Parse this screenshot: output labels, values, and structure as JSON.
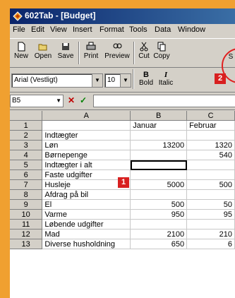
{
  "window": {
    "title": "602Tab - [Budget]"
  },
  "menu": [
    "File",
    "Edit",
    "View",
    "Insert",
    "Format",
    "Tools",
    "Data",
    "Window"
  ],
  "toolbar": {
    "new": "New",
    "open": "Open",
    "save": "Save",
    "print": "Print",
    "preview": "Preview",
    "cut": "Cut",
    "copy": "Copy",
    "partial": "S"
  },
  "format_toolbar": {
    "font": "Arial (Vestligt)",
    "size": "10",
    "bold": "Bold",
    "italic": "Italic",
    "bold_glyph": "B",
    "italic_glyph": "I"
  },
  "formula_bar": {
    "cell_ref": "B5",
    "cancel": "✕",
    "accept": "✓",
    "content": ""
  },
  "callouts": {
    "one": "1",
    "two": "2"
  },
  "sheet": {
    "columns": [
      "A",
      "B",
      "C"
    ],
    "rows": [
      {
        "n": "1",
        "a": "",
        "b": "Januar",
        "c": "Februar"
      },
      {
        "n": "2",
        "a": "Indtægter",
        "b": "",
        "c": ""
      },
      {
        "n": "3",
        "a": "Løn",
        "b": "13200",
        "c": "1320"
      },
      {
        "n": "4",
        "a": "Børnepenge",
        "b": "",
        "c": "540"
      },
      {
        "n": "5",
        "a": "Indtægter i alt",
        "b": "",
        "c": ""
      },
      {
        "n": "6",
        "a": "Faste udgifter",
        "b": "",
        "c": ""
      },
      {
        "n": "7",
        "a": "Husleje",
        "b": "5000",
        "c": "500"
      },
      {
        "n": "8",
        "a": "Afdrag på bil",
        "b": "",
        "c": ""
      },
      {
        "n": "9",
        "a": "El",
        "b": "500",
        "c": "50"
      },
      {
        "n": "10",
        "a": "Varme",
        "b": "950",
        "c": "95"
      },
      {
        "n": "11",
        "a": "Løbende udgifter",
        "b": "",
        "c": ""
      },
      {
        "n": "12",
        "a": "Mad",
        "b": "2100",
        "c": "210"
      },
      {
        "n": "13",
        "a": "Diverse husholdning",
        "b": "650",
        "c": "6"
      }
    ]
  },
  "colors": {
    "callout": "#d82020",
    "titlebar": "#0a246a",
    "background": "#f0a030"
  }
}
